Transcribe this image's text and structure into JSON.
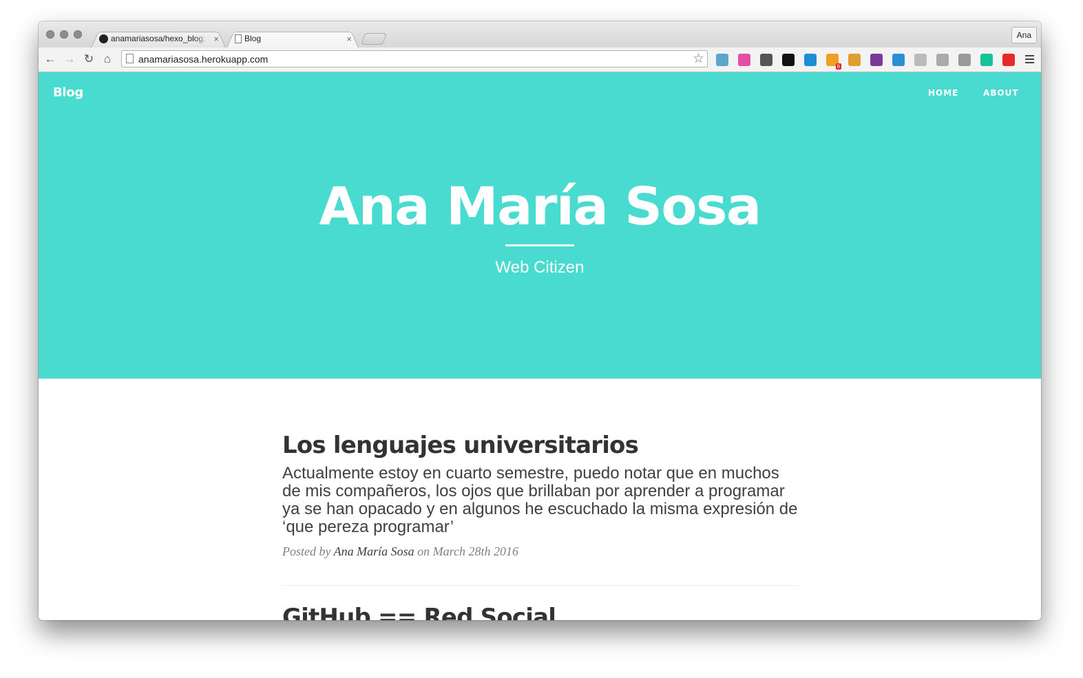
{
  "browser": {
    "tabs": [
      {
        "title": "anamariasosa/hexo_blog: B",
        "close": "×"
      },
      {
        "title": "Blog",
        "close": "×"
      }
    ],
    "profile_name": "Ana",
    "url": "anamariasosa.herokuapp.com",
    "nav": {
      "back": "←",
      "forward": "→",
      "reload": "↻",
      "home": "⌂"
    },
    "star": "☆",
    "extensions": [
      {
        "name": "eyedropper-icon",
        "color": "#5aa7c9"
      },
      {
        "name": "palette-icon",
        "color": "#e24fa4"
      },
      {
        "name": "sync-icon",
        "color": "#555555"
      },
      {
        "name": "eye-icon",
        "color": "#111111"
      },
      {
        "name": "globe-icon",
        "color": "#1a8fd6"
      },
      {
        "name": "pocket-icon",
        "color": "#f0a020"
      },
      {
        "name": "ruler-icon",
        "color": "#e0a030"
      },
      {
        "name": "columns-icon",
        "color": "#7a3a9a"
      },
      {
        "name": "download-icon",
        "color": "#2b8fd8"
      },
      {
        "name": "cloud-icon",
        "color": "#bbbbbb"
      },
      {
        "name": "window-icon",
        "color": "#aaaaaa"
      },
      {
        "name": "brackets-icon",
        "color": "#999999"
      },
      {
        "name": "grammarly-icon",
        "color": "#15c39a"
      },
      {
        "name": "trash-icon",
        "color": "#e62a2a"
      }
    ],
    "badge_count": "6"
  },
  "site": {
    "brand": "Blog",
    "nav": {
      "home": "HOME",
      "about": "ABOUT"
    },
    "accent": "#4adbd0",
    "hero_title": "Ana María Sosa",
    "hero_subtitle": "Web Citizen"
  },
  "posts": [
    {
      "title": "Los lenguajes universitarios",
      "subtitle": "Actualmente estoy en cuarto semestre, puedo notar que en muchos de mis compañeros, los ojos que brillaban por aprender a programar ya se han opacado y en algunos he escuchado la misma expresión de ‘que pereza programar’",
      "meta_prefix": "Posted by",
      "author": "Ana María Sosa",
      "meta_on": "on",
      "date": "March 28th 2016"
    },
    {
      "title": "GitHub == Red Social"
    }
  ]
}
